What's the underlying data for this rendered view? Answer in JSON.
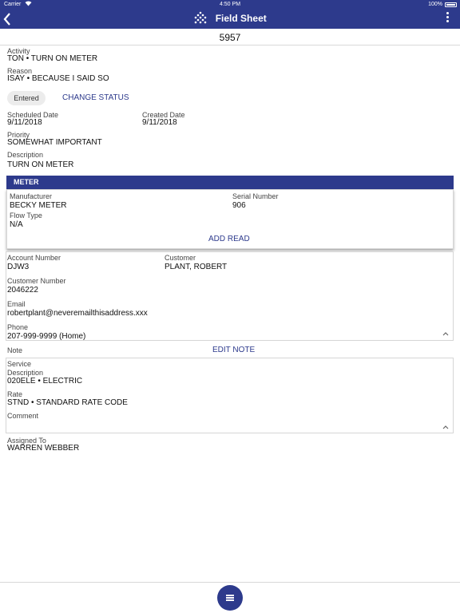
{
  "status_bar": {
    "carrier": "Carrier",
    "time": "4:50 PM",
    "battery": "100%"
  },
  "header": {
    "title": "Field Sheet",
    "back_icon": "back-chevron-icon",
    "menu_icon": "more-vertical-icon",
    "logo_icon": "dotted-diamond-logo-icon"
  },
  "work_order_number": "5957",
  "activity": {
    "label": "Activity",
    "value": "TON • TURN ON METER"
  },
  "reason": {
    "label": "Reason",
    "value": "ISAY • BECAUSE I SAID SO"
  },
  "status": {
    "chip": "Entered",
    "change_link": "CHANGE STATUS"
  },
  "scheduled_date": {
    "label": "Scheduled Date",
    "value": "9/11/2018"
  },
  "created_date": {
    "label": "Created Date",
    "value": "9/11/2018"
  },
  "priority": {
    "label": "Priority",
    "value": "SOMEWHAT IMPORTANT"
  },
  "description": {
    "label": "Description",
    "value": "TURN ON METER"
  },
  "meter": {
    "header": "METER",
    "manufacturer": {
      "label": "Manufacturer",
      "value": "BECKY METER"
    },
    "serial_number": {
      "label": "Serial Number",
      "value": "906"
    },
    "flow_type": {
      "label": "Flow Type",
      "value": "N/A"
    },
    "add_read": "ADD READ"
  },
  "customer_box": {
    "account_number": {
      "label": "Account Number",
      "value": "DJW3"
    },
    "customer": {
      "label": "Customer",
      "value": "PLANT, ROBERT"
    },
    "customer_number": {
      "label": "Customer Number",
      "value": "2046222"
    },
    "email": {
      "label": "Email",
      "value": "robertplant@neveremailthisaddress.xxx"
    },
    "phone": {
      "label": "Phone",
      "value": "207-999-9999 (Home)"
    },
    "collapse_icon": "chevron-up-icon"
  },
  "note": {
    "label": "Note",
    "edit_link": "EDIT NOTE"
  },
  "service_box": {
    "service_label": "Service",
    "description": {
      "label": "Description",
      "value": "020ELE • ELECTRIC"
    },
    "rate": {
      "label": "Rate",
      "value": "STND • STANDARD RATE CODE"
    },
    "comment": {
      "label": "Comment",
      "value": ""
    },
    "collapse_icon": "chevron-up-icon"
  },
  "assigned_to": {
    "label": "Assigned To",
    "value": "WARREN WEBBER"
  },
  "fab_icon": "hamburger-menu-icon",
  "colors": {
    "brand": "#2d3a8c",
    "background": "#ffffff",
    "chip": "#ececec"
  }
}
